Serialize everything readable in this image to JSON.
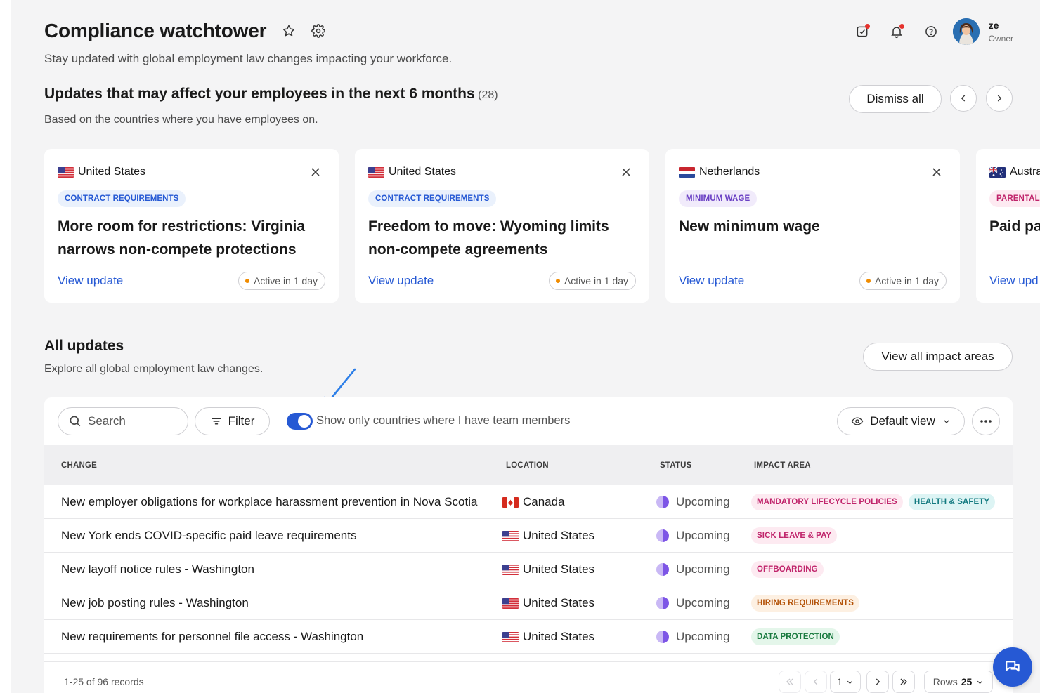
{
  "header": {
    "title": "Compliance watchtower",
    "subtitle": "Stay updated with global employment law changes impacting your workforce."
  },
  "user": {
    "name": "ze",
    "role": "Owner"
  },
  "upcoming": {
    "title": "Updates that may affect your employees in the next 6 months",
    "count": "(28)",
    "subtitle": "Based on the countries where you have employees on.",
    "dismiss_label": "Dismiss all",
    "cards": [
      {
        "country": "United States",
        "tag": "CONTRACT REQUIREMENTS",
        "title": "More room for restrictions: Virginia narrows non-compete protections",
        "link": "View update",
        "status": "Active in 1 day"
      },
      {
        "country": "United States",
        "tag": "CONTRACT REQUIREMENTS",
        "title": "Freedom to move: Wyoming limits non-compete agreements",
        "link": "View update",
        "status": "Active in 1 day"
      },
      {
        "country": "Netherlands",
        "tag": "MINIMUM WAGE",
        "title": "New minimum wage",
        "link": "View update",
        "status": "Active in 1 day"
      },
      {
        "country": "Austra",
        "tag": "PARENTAL",
        "title": "Paid pa",
        "link": "View upd",
        "status": ""
      }
    ]
  },
  "all_updates": {
    "title": "All updates",
    "subtitle": "Explore all global employment law changes.",
    "view_all_label": "View all impact areas",
    "search_placeholder": "Search",
    "filter_label": "Filter",
    "toggle_label": "Show only countries where I have team members",
    "toggle_on": true,
    "view_label": "Default view",
    "columns": {
      "change": "CHANGE",
      "location": "LOCATION",
      "status": "STATUS",
      "impact": "IMPACT AREA"
    },
    "rows": [
      {
        "change": "New employer obligations for workplace harassment prevention in Nova Scotia",
        "location": "Canada",
        "status": "Upcoming",
        "tags": [
          "MANDATORY LIFECYCLE POLICIES",
          "HEALTH & SAFETY"
        ]
      },
      {
        "change": "New York ends COVID-specific paid leave requirements",
        "location": "United States",
        "status": "Upcoming",
        "tags": [
          "SICK LEAVE & PAY"
        ]
      },
      {
        "change": "New layoff notice rules - Washington",
        "location": "United States",
        "status": "Upcoming",
        "tags": [
          "OFFBOARDING"
        ]
      },
      {
        "change": "New job posting rules - Washington",
        "location": "United States",
        "status": "Upcoming",
        "tags": [
          "HIRING REQUIREMENTS"
        ]
      },
      {
        "change": "New requirements for personnel file access - Washington",
        "location": "United States",
        "status": "Upcoming",
        "tags": [
          "DATA PROTECTION"
        ]
      }
    ],
    "pagination": {
      "records": "1-25 of 96 records",
      "page": "1",
      "rows_label": "Rows",
      "rows_value": "25"
    }
  },
  "colors": {
    "accent": "#2659d4",
    "tag_contract_bg": "#eaf1fc",
    "tag_contract_fg": "#2659d4",
    "tag_wage_bg": "#f1ebfb",
    "tag_wage_fg": "#6a3fc4",
    "tag_parental_bg": "#fdeaf1",
    "tag_parental_fg": "#c0246b",
    "tag_teal_bg": "#ddf4f4",
    "tag_teal_fg": "#137a80",
    "tag_orange_bg": "#fdf0e2",
    "tag_orange_fg": "#b45309",
    "tag_green_bg": "#e4f6ea",
    "tag_green_fg": "#187a3e"
  }
}
